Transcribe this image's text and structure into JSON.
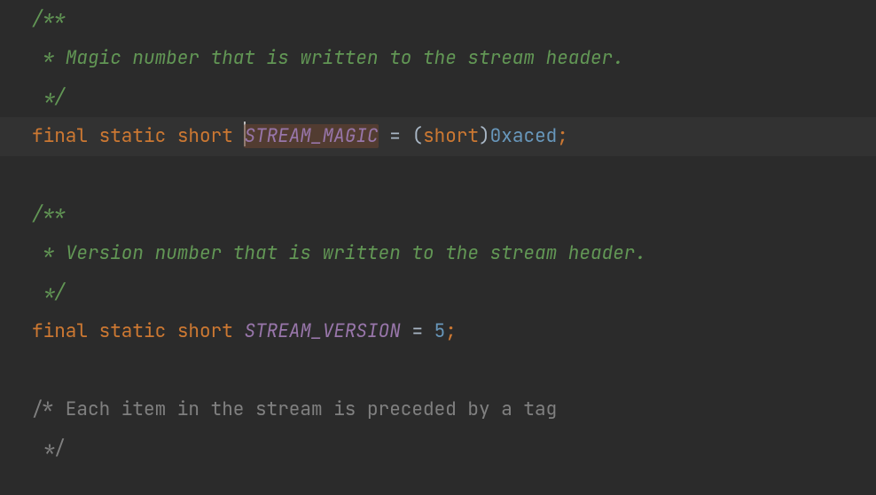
{
  "code": {
    "l1": "/**",
    "l2_pre": " * ",
    "l2_txt": "Magic number that is written to the stream header.",
    "l3": " */",
    "l4_kw1": "final",
    "l4_kw2": "static",
    "l4_kw3": "short",
    "l4_name": "STREAM_MAGIC",
    "l4_eq": " = ",
    "l4_op": "(",
    "l4_cast": "short",
    "l4_cp": ")",
    "l4_val": "0xaced",
    "l4_semi": ";",
    "l6": "/**",
    "l7_pre": " * ",
    "l7_txt": "Version number that is written to the stream header.",
    "l8": " */",
    "l9_kw1": "final",
    "l9_kw2": "static",
    "l9_kw3": "short",
    "l9_name": "STREAM_VERSION",
    "l9_eq": " = ",
    "l9_val": "5",
    "l9_semi": ";",
    "l11": "/* Each item in the stream is preceded by a tag",
    "l12": " */"
  },
  "icon": {
    "bulb_color": "#f0a732"
  }
}
